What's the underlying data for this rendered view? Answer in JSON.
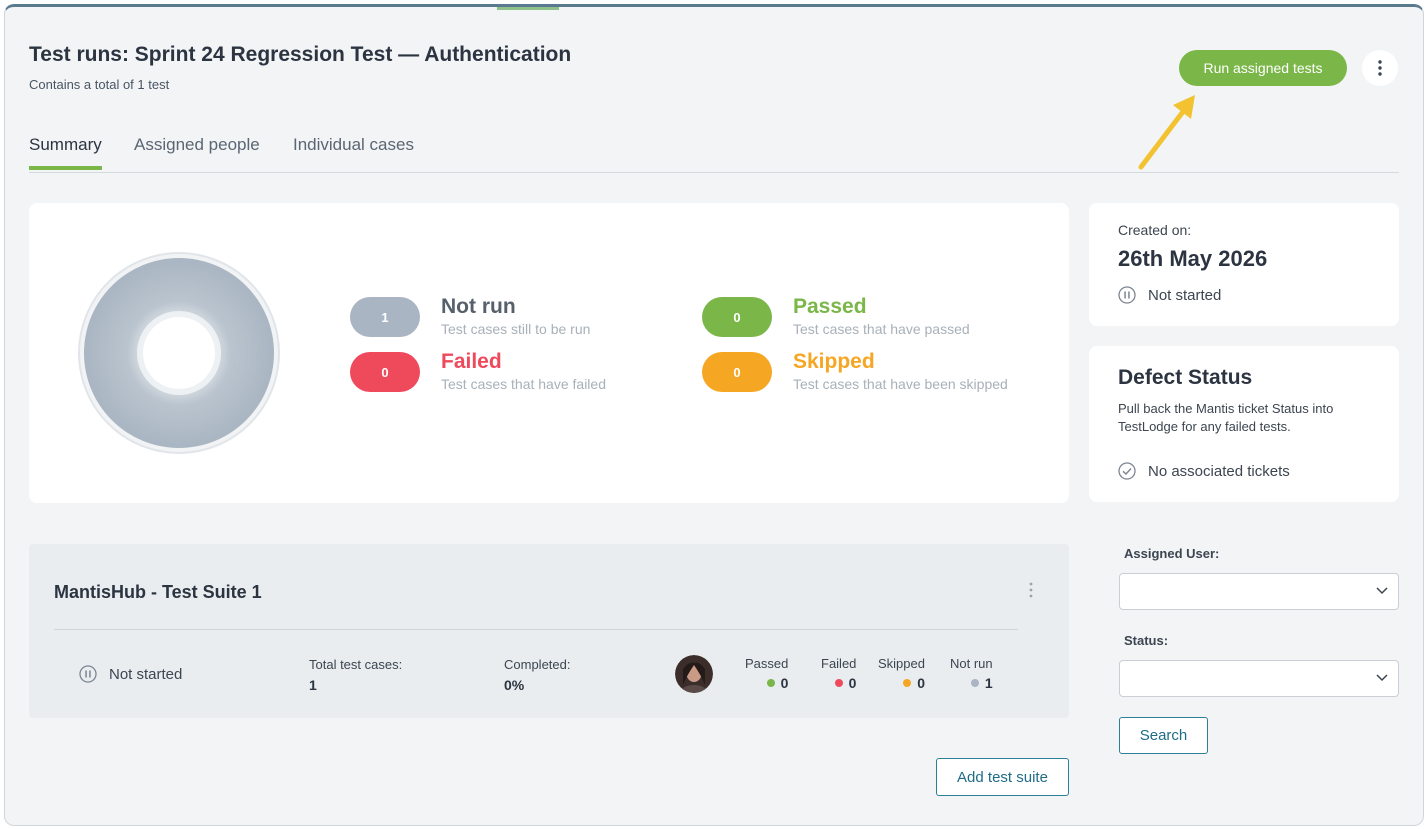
{
  "header": {
    "title": "Test runs: Sprint 24 Regression Test — Authentication",
    "subtitle": "Contains a total of 1 test",
    "run_button": "Run assigned tests"
  },
  "tabs": [
    {
      "label": "Summary",
      "active": true
    },
    {
      "label": "Assigned people",
      "active": false
    },
    {
      "label": "Individual cases",
      "active": false
    }
  ],
  "summary": {
    "not_run": {
      "count": "1",
      "title": "Not run",
      "desc": "Test cases still to be run",
      "color": "#a9b5c2"
    },
    "failed": {
      "count": "0",
      "title": "Failed",
      "desc": "Test cases that have failed",
      "color": "#ef4a5c"
    },
    "passed": {
      "count": "0",
      "title": "Passed",
      "desc": "Test cases that have passed",
      "color": "#7ab648"
    },
    "skipped": {
      "count": "0",
      "title": "Skipped",
      "desc": "Test cases that have been skipped",
      "color": "#f5a623"
    }
  },
  "created": {
    "label": "Created on:",
    "date": "26th May 2026",
    "status": "Not started"
  },
  "defect": {
    "title": "Defect Status",
    "description": "Pull back the Mantis ticket Status into TestLodge for any failed tests.",
    "tickets": "No associated tickets"
  },
  "suite": {
    "title": "MantisHub - Test Suite 1",
    "status": "Not started",
    "total_label": "Total test cases:",
    "total_value": "1",
    "completed_label": "Completed:",
    "completed_value": "0%",
    "counts": {
      "passed_label": "Passed",
      "passed_value": "0",
      "failed_label": "Failed",
      "failed_value": "0",
      "skipped_label": "Skipped",
      "skipped_value": "0",
      "notrun_label": "Not run",
      "notrun_value": "1"
    }
  },
  "buttons": {
    "add_suite": "Add test suite",
    "search": "Search"
  },
  "filters": {
    "assigned_user_label": "Assigned User:",
    "assigned_user_value": "",
    "status_label": "Status:",
    "status_value": ""
  },
  "colors": {
    "accent": "#7ab648",
    "link": "#1f6c86"
  }
}
